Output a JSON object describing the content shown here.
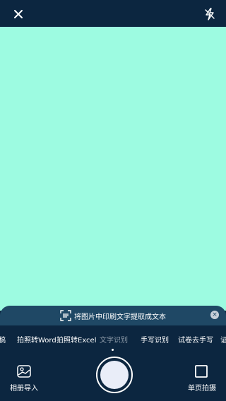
{
  "header": {
    "close_icon": "close-icon",
    "flash_icon": "flash-icon"
  },
  "tip": {
    "text": "将图片中印刷文字提取成文本",
    "close_symbol": "×"
  },
  "modes": [
    {
      "label": "稿"
    },
    {
      "label": "拍照转Word"
    },
    {
      "label": "拍照转Excel"
    },
    {
      "label": "文字识别"
    },
    {
      "label": "手写识别"
    },
    {
      "label": "试卷去手写"
    },
    {
      "label": "证"
    }
  ],
  "bottom": {
    "album_label": "相册导入",
    "single_label": "单页拍摄"
  },
  "colors": {
    "background": "#0c2640",
    "viewfinder": "#9dfbe1",
    "banner": "#1f4865"
  }
}
